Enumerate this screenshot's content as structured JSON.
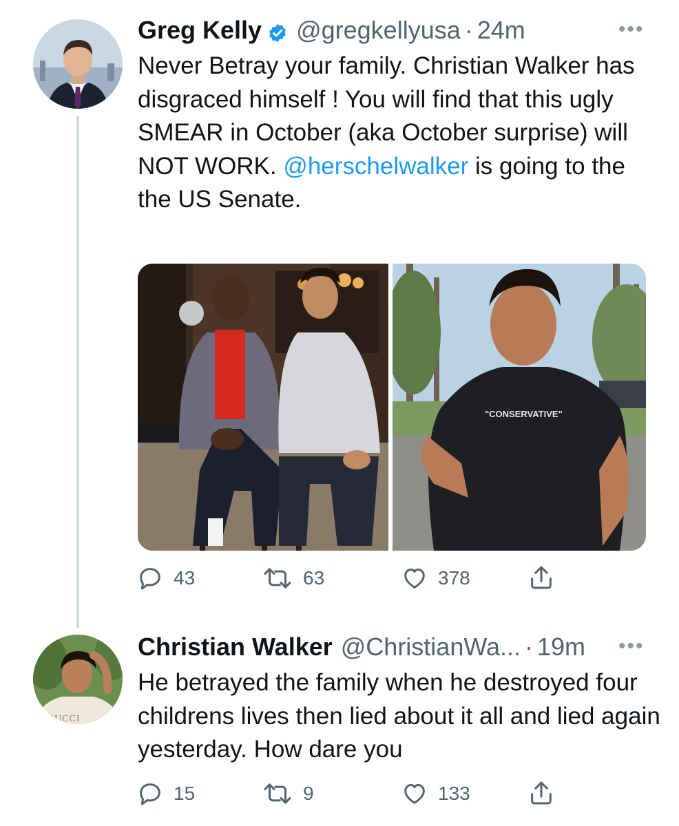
{
  "tweets": [
    {
      "name": "Greg Kelly",
      "handle": "@gregkellyusa",
      "time": "24m",
      "text_before": "Never Betray your family. Christian Walker has disgraced himself ! You will find that this ugly SMEAR in October (aka October surprise) will NOT WORK.  ",
      "mention": "@herschelwalker",
      "text_after": " is going to the the US Senate.",
      "media_text": "\"CONSERVATIVE\"",
      "stats": {
        "replies": "43",
        "retweets": "63",
        "likes": "378"
      }
    },
    {
      "name": "Christian Walker",
      "handle": "@ChristianWa...",
      "time": "19m",
      "text": "He betrayed the family when he destroyed four childrens lives then lied about it all and lied again yesterday. How dare you",
      "shirt_text": "GUCCI",
      "stats": {
        "replies": "15",
        "retweets": "9",
        "likes": "133"
      }
    }
  ],
  "ui": {
    "dot": "·",
    "more": "•••"
  },
  "colors": {
    "text": "#0f1419",
    "secondary": "#536471",
    "link": "#1d9bf0",
    "verified": "#1d9bf0",
    "thread_line": "#cfd9de"
  },
  "icons": [
    "verified-badge-icon",
    "more-icon",
    "reply-icon",
    "retweet-icon",
    "like-icon",
    "share-icon"
  ]
}
